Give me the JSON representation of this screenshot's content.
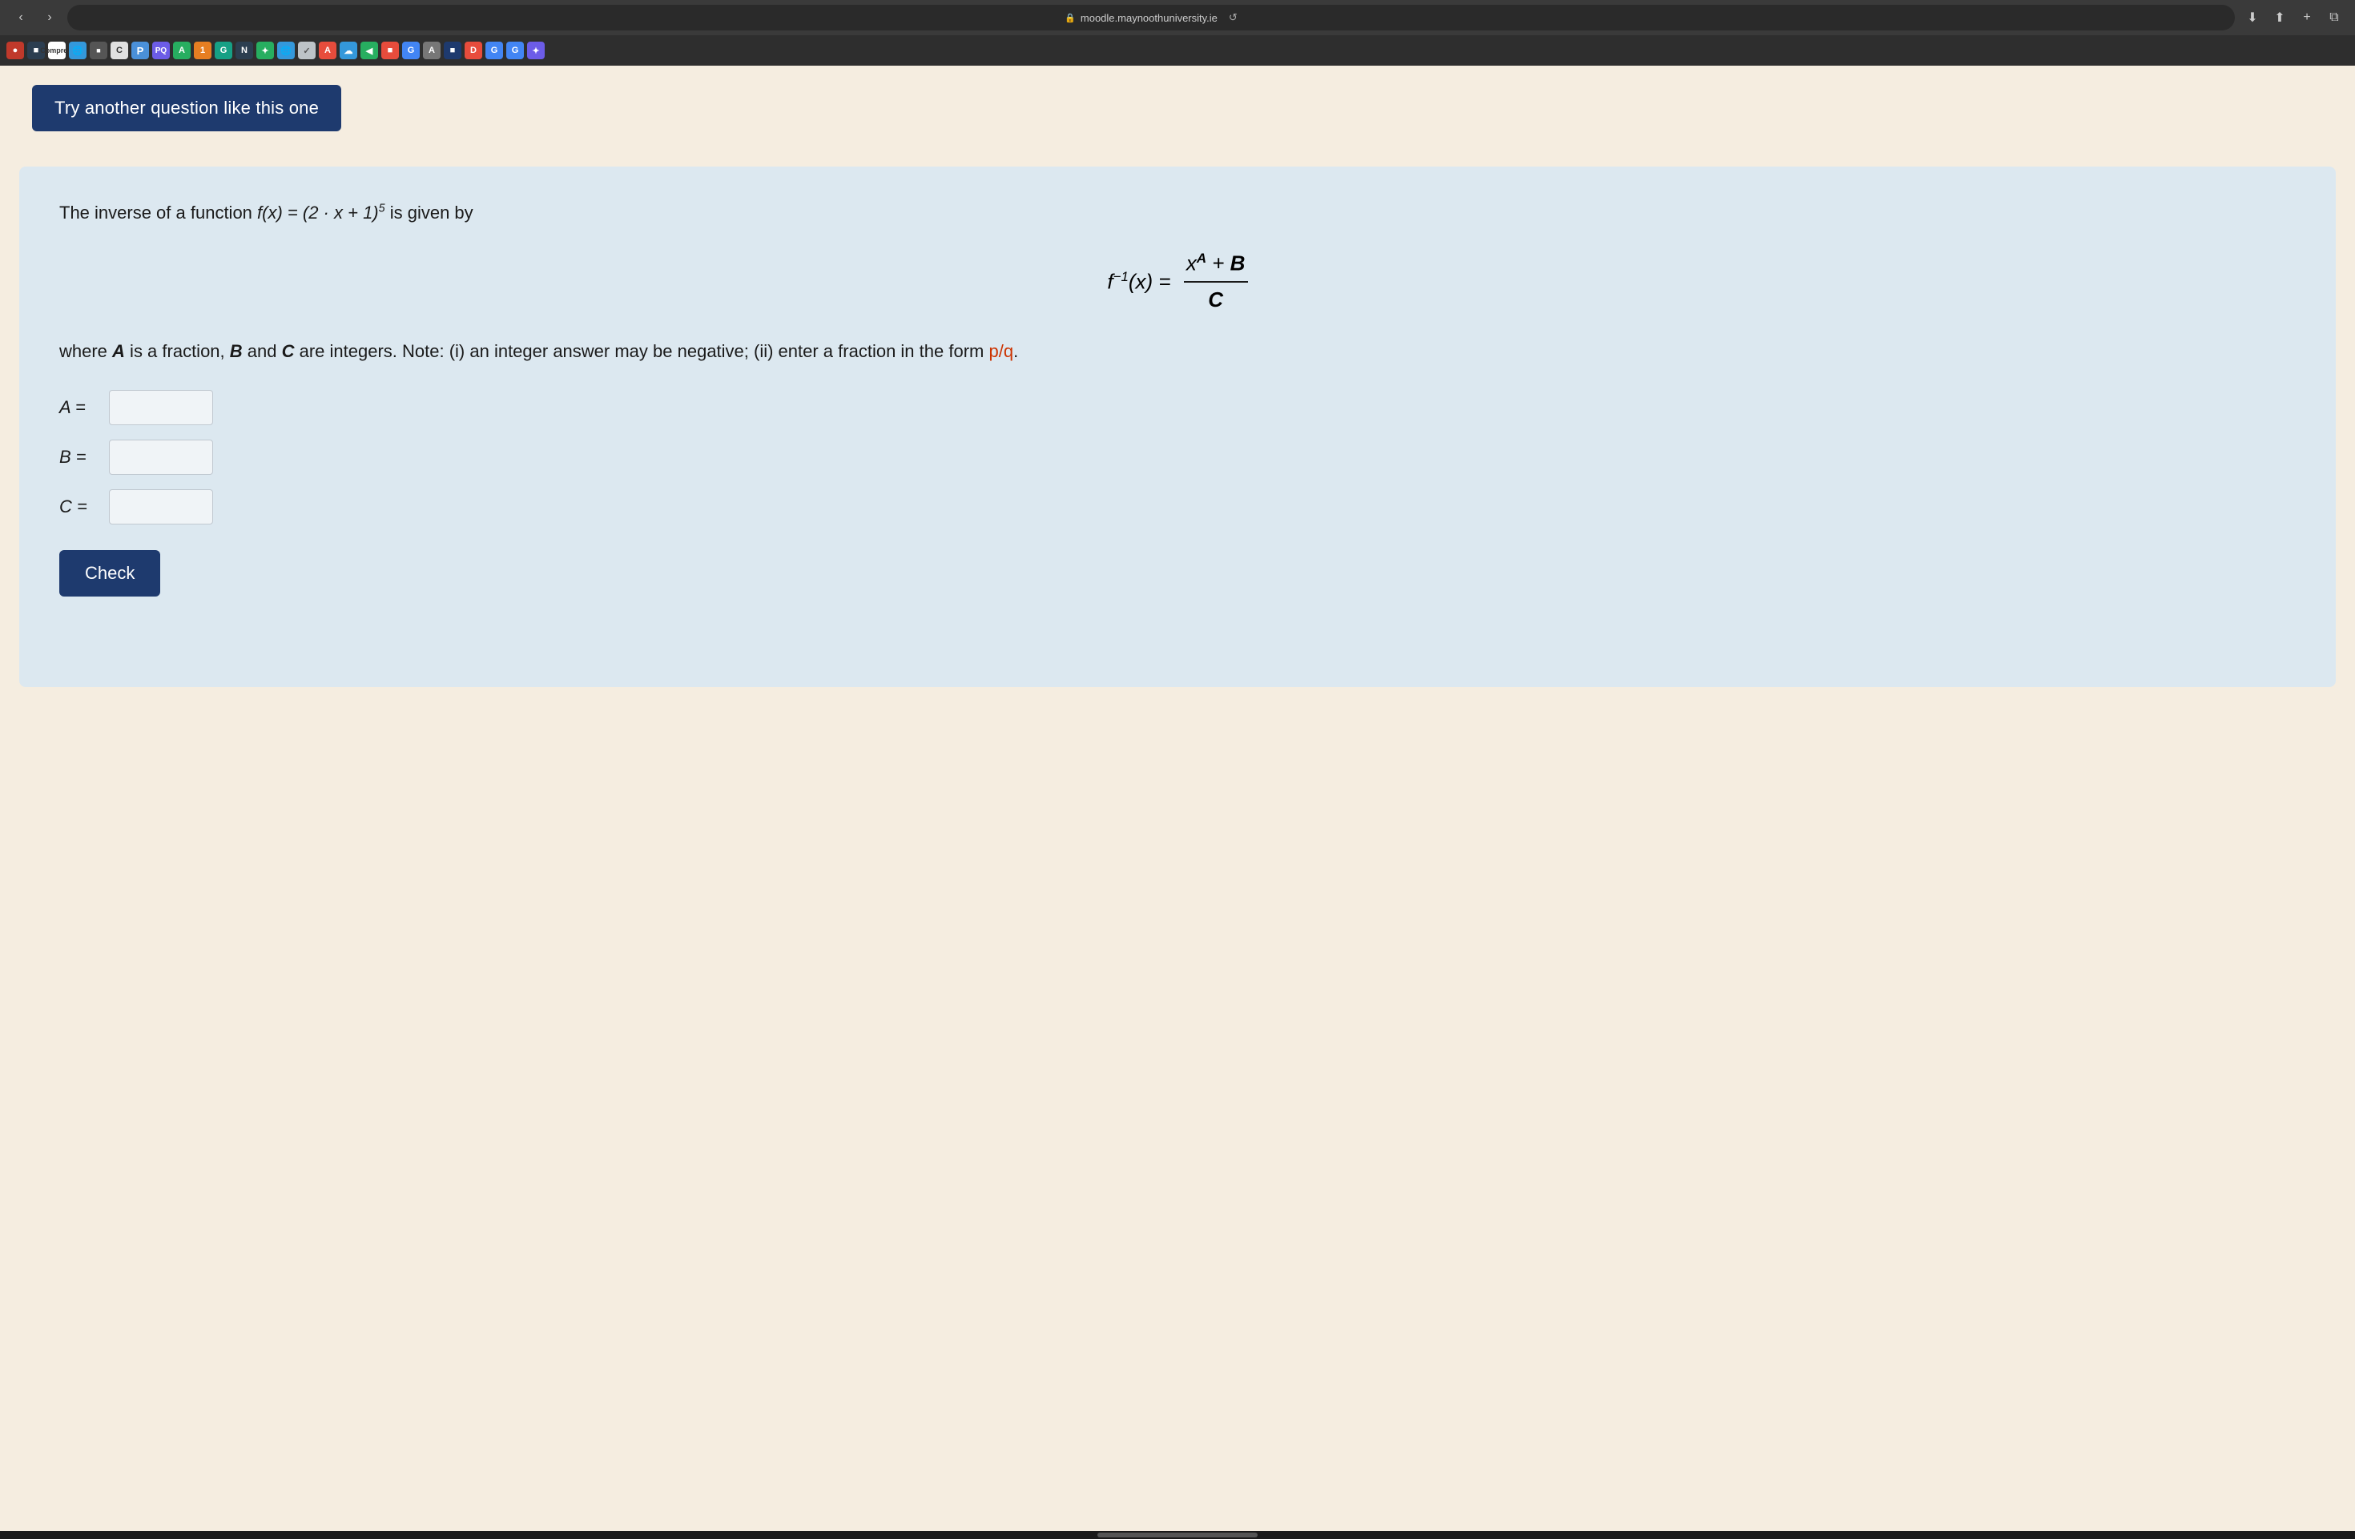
{
  "browser": {
    "url": "moodle.maynoothuniversity.ie",
    "reload_tooltip": "Reload"
  },
  "banner": {
    "try_button_label": "Try another question like this one"
  },
  "question": {
    "intro": "The inverse of a function",
    "function_expr": "f(x) = (2 · x + 1)",
    "function_exp": "5",
    "intro_suffix": "is given by",
    "formula_lhs": "f⁻¹(x) =",
    "numerator": "x",
    "numerator_exp": "A",
    "numerator_plus": "+ B",
    "denominator": "C",
    "description_line1": "where",
    "A_var": "A",
    "desc_A": "is a fraction,",
    "B_var": "B",
    "desc_B": "and",
    "C_var": "C",
    "desc_C": "are integers. Note: (i) an integer answer may be negative; (ii) enter a fraction in the form",
    "fraction_hint": "p/q",
    "period": ".",
    "label_A": "A =",
    "label_B": "B =",
    "label_C": "C =",
    "check_label": "Check"
  },
  "tabs": [
    {
      "color": "#e74c3c",
      "label": "●"
    },
    {
      "color": "#3498db",
      "label": "■"
    },
    {
      "color": "#555",
      "label": "C",
      "text": "C"
    },
    {
      "color": "#4a90d9",
      "label": "P"
    },
    {
      "color": "#6c5ce7",
      "label": "PQ"
    },
    {
      "color": "#27ae60",
      "label": "A"
    },
    {
      "color": "#e67e22",
      "label": "1"
    },
    {
      "color": "#16a085",
      "label": "G"
    },
    {
      "color": "#2c3e50",
      "label": "N"
    },
    {
      "color": "#27ae60",
      "label": "✦"
    },
    {
      "color": "#3498db",
      "label": "🌐"
    },
    {
      "color": "#95a5a6",
      "label": "✓"
    },
    {
      "color": "#e74c3c",
      "label": "A"
    },
    {
      "color": "#3498db",
      "label": "☁"
    },
    {
      "color": "#27ae60",
      "label": "◀"
    },
    {
      "color": "#e74c3c",
      "label": "■"
    },
    {
      "color": "#4285f4",
      "label": "G"
    },
    {
      "color": "#555",
      "label": "A"
    },
    {
      "color": "#1e3a6e",
      "label": "■"
    },
    {
      "color": "#e74c3c",
      "label": "D"
    },
    {
      "color": "#4285f4",
      "label": "G"
    },
    {
      "color": "#4285f4",
      "label": "G"
    },
    {
      "color": "#6c5ce7",
      "label": "✦"
    }
  ]
}
